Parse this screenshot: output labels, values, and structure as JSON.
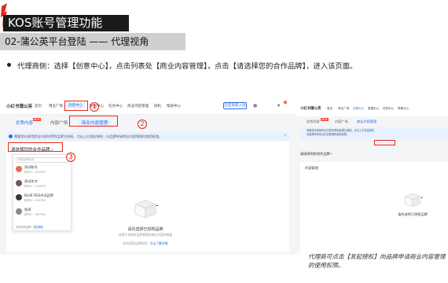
{
  "slide": {
    "title": "KOS账号管理功能",
    "subtitle": "02-蒲公英平台登陆 —— 代理视角",
    "bullet": "代理商侧：选择【创意中心】，点击列表处【商业内容管理】，点击【请选择您的合作品牌】，进入该页面。",
    "caption": "代理商可点击【发起授权】向品牌申请商业内容管理的使用权限。"
  },
  "left_screen": {
    "logo": "小红书蒲公英",
    "nav_items": [
      "首页",
      "博主广场",
      "创意中心",
      "数据中心",
      "任务中心",
      "商业内容管理",
      "商机",
      "帮助中心"
    ],
    "nav_button": "已是商家入驻",
    "tabs": [
      "优秀内容",
      "内容广场",
      "商业内容管理"
    ],
    "new_badge": "NEW",
    "notice": "需要您在使用商业内容时得到品牌方授权。点击上方发起授权，向品牌申请商业内容管理的使用权限。",
    "brand_select": "请选择您的合作品牌",
    "dropdown": {
      "search_placeholder": "搜索品牌名称",
      "items": [
        {
          "name": "测试账号",
          "sub": "账号ID：1234567"
        },
        {
          "name": "测试名字",
          "sub": "账号ID：2345678"
        },
        {
          "name": "BLUE RESALE品牌",
          "sub": "账号ID：3456789"
        },
        {
          "name": "秋雨",
          "sub": "账号ID：4567890"
        }
      ],
      "footer_prefix": "没有找到品牌？",
      "footer_link": "发起授权"
    },
    "empty": {
      "title": "请先选择已授权品牌",
      "desc": "选择已有授权品牌管理其商业内容的数据",
      "link_prefix": "如何获取品牌授权？",
      "link": "点击了解详情"
    },
    "callouts": [
      "1",
      "2",
      "3"
    ]
  },
  "right_screen": {
    "logo": "小红书蒲公英",
    "nav_items": [
      "首页",
      "博主广场",
      "创意中心",
      "数据中心",
      "任务中心",
      "帮助中心"
    ],
    "tabs": [
      "优秀内容",
      "内容广场",
      "商业内容管理"
    ],
    "new_badge": "NEW",
    "notice_line1": "需要您在使用商业内容时得到品牌方授权。点击上方",
    "notice_link": "发起授权",
    "notice_line2": "向品牌申请商业内容管理的使用权限。",
    "brand_select": "请选择您的合作品牌",
    "panel_title": "内容管理",
    "empty_title": "请先选择已授权品牌"
  },
  "colors": {
    "accent_red": "#e8261c",
    "primary_blue": "#2b6de6",
    "title_bar": "#1a1a1a",
    "subtitle_bar": "#cfcfcf"
  }
}
